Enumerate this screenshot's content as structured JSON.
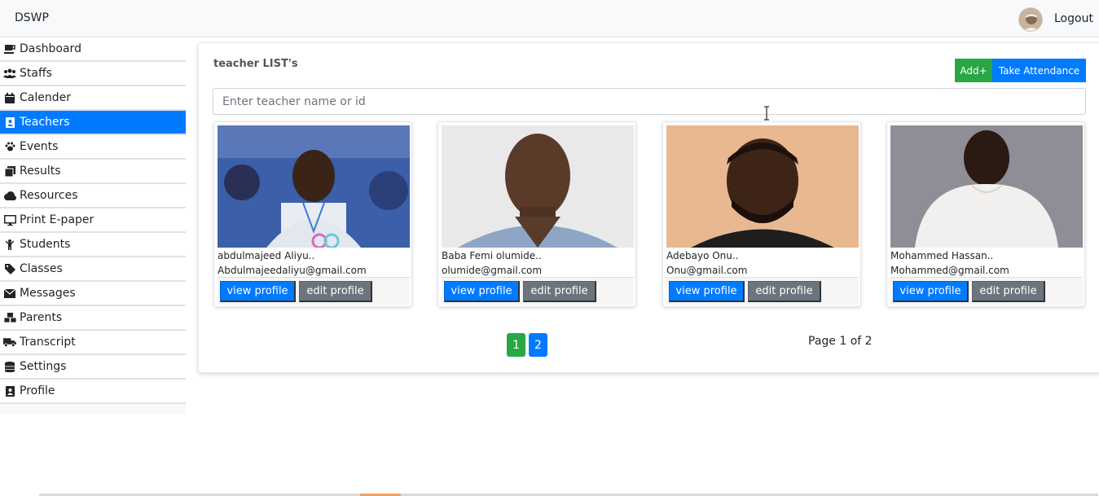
{
  "header": {
    "brand": "DSWP",
    "logout_label": "Logout"
  },
  "sidebar": {
    "items": [
      {
        "label": "Dashboard",
        "icon": "coffee-icon"
      },
      {
        "label": "Staffs",
        "icon": "users-icon"
      },
      {
        "label": "Calender",
        "icon": "calendar-icon"
      },
      {
        "label": "Teachers",
        "icon": "address-card-icon",
        "active": true
      },
      {
        "label": "Events",
        "icon": "paw-icon"
      },
      {
        "label": "Results",
        "icon": "clone-icon"
      },
      {
        "label": "Resources",
        "icon": "cloud-icon"
      },
      {
        "label": "Print E-paper",
        "icon": "monitor-icon"
      },
      {
        "label": "Students",
        "icon": "child-icon"
      },
      {
        "label": "Classes",
        "icon": "tag-icon"
      },
      {
        "label": "Messages",
        "icon": "envelope-icon"
      },
      {
        "label": "Parents",
        "icon": "cubes-icon"
      },
      {
        "label": "Transcript",
        "icon": "truck-icon"
      },
      {
        "label": "Settings",
        "icon": "database-icon"
      },
      {
        "label": "Profile",
        "icon": "id-badge-icon"
      }
    ]
  },
  "main": {
    "title": "teacher LIST's",
    "add_label": "Add+",
    "attendance_label": "Take Attendance",
    "search_placeholder": "Enter teacher name or id",
    "teachers": [
      {
        "name": "abdulmajeed Aliyu..",
        "email": "Abdulmajeedaliyu@gmail.com"
      },
      {
        "name": "Baba Femi olumide..",
        "email": "olumide@gmail.com"
      },
      {
        "name": "Adebayo Onu..",
        "email": "Onu@gmail.com"
      },
      {
        "name": "Mohammed Hassan..",
        "email": "Mohammed@gmail.com"
      }
    ],
    "view_label": "view profile",
    "edit_label": "edit profile",
    "pages": [
      "1",
      "2"
    ],
    "page_info": "Page 1 of 2"
  },
  "colors": {
    "primary": "#007bff",
    "success": "#28a745",
    "secondary": "#6c757d"
  }
}
